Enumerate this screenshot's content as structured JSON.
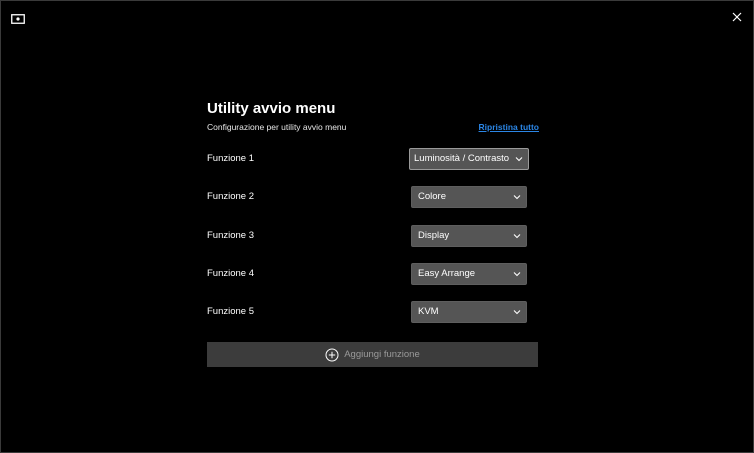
{
  "window": {
    "app_icon": "monitor-icon",
    "close_icon": "close-icon"
  },
  "page": {
    "title": "Utility avvio menu",
    "subtitle": "Configurazione per utility avvio menu",
    "reset_label": "Ripristina tutto"
  },
  "functions": [
    {
      "label": "Funzione 1",
      "value": "Luminosità / Contrasto"
    },
    {
      "label": "Funzione 2",
      "value": "Colore"
    },
    {
      "label": "Funzione 3",
      "value": "Display"
    },
    {
      "label": "Funzione 4",
      "value": "Easy Arrange"
    },
    {
      "label": "Funzione 5",
      "value": "KVM"
    }
  ],
  "add_function": {
    "label": "Aggiungi funzione",
    "icon": "plus-circle-icon"
  },
  "colors": {
    "background": "#000000",
    "link": "#2b86e6",
    "dropdown": "#555555",
    "add_button": "#3c3c3c"
  }
}
